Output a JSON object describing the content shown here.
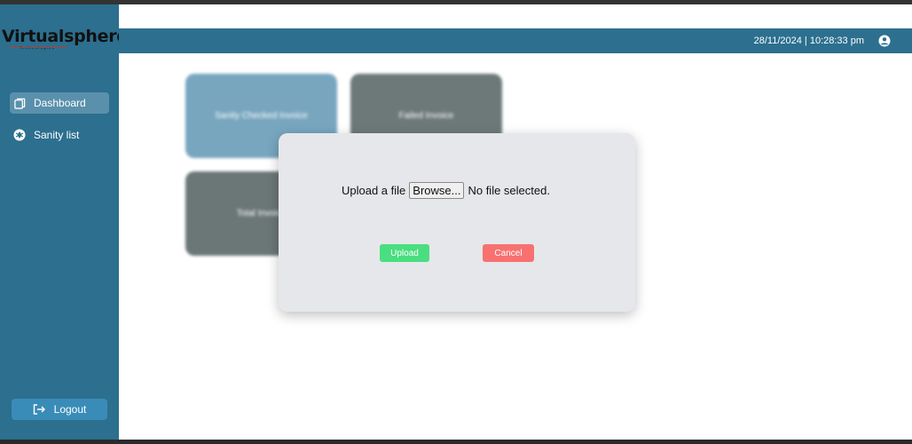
{
  "brand": {
    "name": "Virtualsphere",
    "tagline": "Technologies"
  },
  "sidebar": {
    "items": [
      {
        "label": "Dashboard",
        "icon": "copy-icon",
        "active": true
      },
      {
        "label": "Sanity list",
        "icon": "aperture-icon",
        "active": false
      }
    ],
    "logout_label": "Logout"
  },
  "header": {
    "datetime": "28/11/2024 | 10:28:33 pm",
    "user_icon": "user-circle-icon"
  },
  "cards": [
    {
      "label": "Sanity Checked Invoice"
    },
    {
      "label": "Failed Invoice"
    },
    {
      "label": "Total Invoice"
    }
  ],
  "modal": {
    "upload_label": "Upload a file",
    "browse_label": "Browse...",
    "file_status": "No file selected.",
    "upload_button": "Upload",
    "cancel_button": "Cancel"
  },
  "colors": {
    "sidebar": "#2c6f8f",
    "upload": "#4ade80",
    "cancel": "#f87171"
  }
}
